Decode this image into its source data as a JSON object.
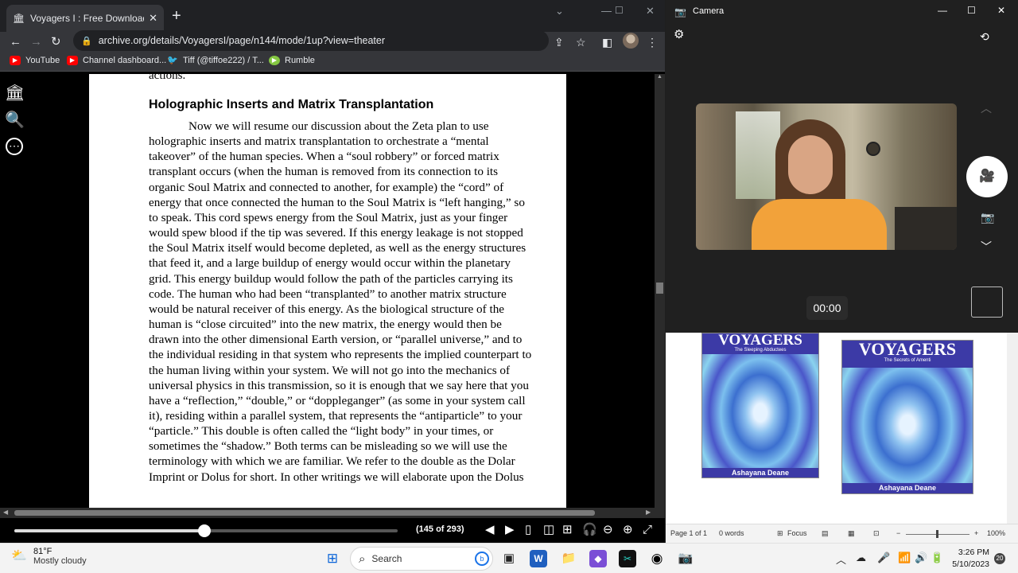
{
  "browser": {
    "tab_title": "Voyagers I : Free Download, Borr",
    "tab_close": "✕",
    "new_tab": "+",
    "url": "archive.org/details/VoyagersI/page/n144/mode/1up?view=theater",
    "bookmarks": [
      {
        "label": "YouTube",
        "color": "#ff0000"
      },
      {
        "label": "Channel dashboard...",
        "color": "#ff0000"
      },
      {
        "label": "Tiff (@tiffoe222) / T...",
        "color": "#1d9bf0"
      },
      {
        "label": "Rumble",
        "color": "#85c742"
      }
    ]
  },
  "book": {
    "pre_line": "actions.",
    "heading": "Holographic Inserts and Matrix Transplantation",
    "paragraph": "Now we will resume our discussion about the Zeta plan to use holographic inserts and matrix transplantation to orchestrate a “mental takeover” of the human species. When a “soul robbery” or forced matrix transplant occurs (when the human is removed from its connection to its organic Soul Matrix and connected to another, for example) the “cord” of energy that once connected the human to the Soul Matrix is “left hanging,” so to speak. This cord spews energy from the Soul Matrix, just as your finger would spew blood if the tip was severed. If this energy leakage is not stopped the Soul Matrix itself would become depleted, as well as the energy structures that feed it, and a large buildup of energy would occur within the planetary grid. This energy buildup would follow the path of the particles carrying its code. The human who had been “transplanted” to another matrix structure would be natural receiver of this energy. As the biological structure of the human is “close circuited” into the new matrix, the energy would then be drawn into the other dimensional Earth version, or “parallel universe,” and to the individual residing in that system who represents the implied counterpart to the human living within your system. We will not go into the mechanics of universal physics in this transmission, so it is enough that we say here that you have a “reflection,” “double,” or “doppleganger” (as some in your system call it), residing within a parallel system, that represents the “antiparticle” to your “particle.” This double is often called the “light body” in your times, or sometimes the “shadow.” Both terms can be misleading so we will use the terminology with which we are familiar. We refer to the double as the Dolar Imprint or Dolus for short. In other writings we will elaborate upon the Dolus",
    "page_count": "(145 of 293)",
    "progress": 0.495
  },
  "camera": {
    "title": "Camera",
    "timer": "00:00"
  },
  "word": {
    "book1": {
      "title": "VOYAGERS",
      "subtitle": "The Sleeping Abductees",
      "author": "Ashayana Deane"
    },
    "book2": {
      "title": "VOYAGERS",
      "subtitle": "The Secrets of Amenti",
      "author": "Ashayana Deane"
    },
    "status": {
      "page": "Page 1 of 1",
      "words": "0 words",
      "focus": "Focus",
      "zoom": "100%"
    }
  },
  "taskbar": {
    "temp": "81°F",
    "weather": "Mostly cloudy",
    "search": "Search",
    "time": "3:26 PM",
    "date": "5/10/2023",
    "notifications": "20"
  }
}
